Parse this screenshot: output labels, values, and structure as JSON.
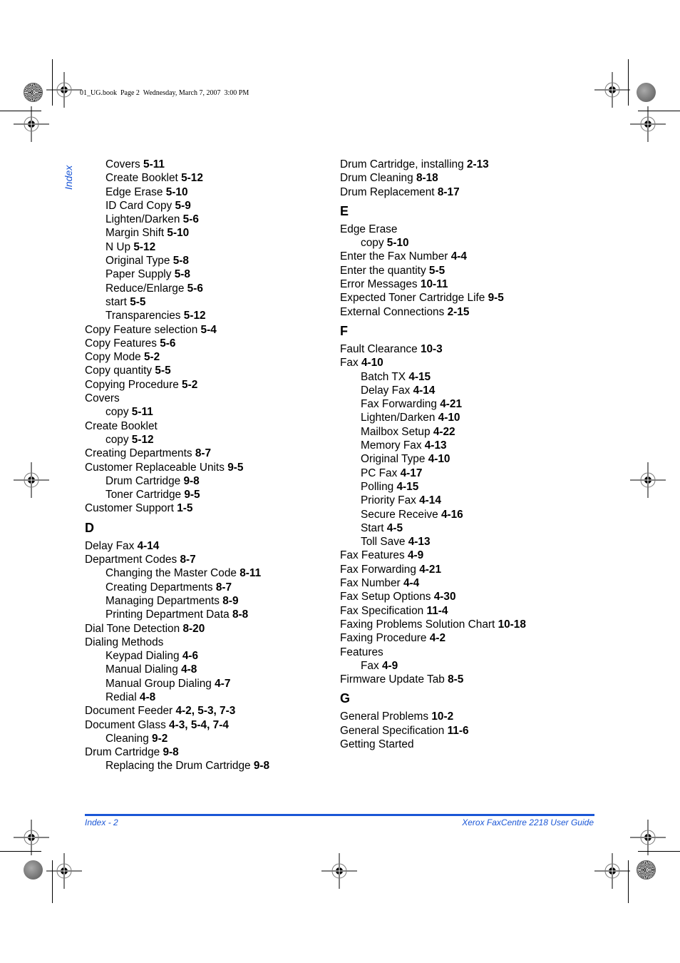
{
  "slug": "01_UG.book  Page 2  Wednesday, March 7, 2007  3:00 PM",
  "side_tab": "Index",
  "footer": {
    "left": "Index - 2",
    "right": "Xerox FaxCentre 2218 User Guide"
  },
  "colors": {
    "accent": "#1a56d6"
  },
  "left_column": [
    {
      "type": "sub",
      "text": "Covers",
      "pages": "5-11"
    },
    {
      "type": "sub",
      "text": "Create Booklet",
      "pages": "5-12"
    },
    {
      "type": "sub",
      "text": "Edge Erase",
      "pages": "5-10"
    },
    {
      "type": "sub",
      "text": "ID Card Copy",
      "pages": "5-9"
    },
    {
      "type": "sub",
      "text": "Lighten/Darken",
      "pages": "5-6"
    },
    {
      "type": "sub",
      "text": "Margin Shift",
      "pages": "5-10"
    },
    {
      "type": "sub",
      "text": "N Up",
      "pages": "5-12"
    },
    {
      "type": "sub",
      "text": "Original Type",
      "pages": "5-8"
    },
    {
      "type": "sub",
      "text": "Paper Supply",
      "pages": "5-8"
    },
    {
      "type": "sub",
      "text": "Reduce/Enlarge",
      "pages": "5-6"
    },
    {
      "type": "sub",
      "text": "start",
      "pages": "5-5"
    },
    {
      "type": "sub",
      "text": "Transparencies",
      "pages": "5-12"
    },
    {
      "type": "main",
      "text": "Copy Feature selection",
      "pages": "5-4"
    },
    {
      "type": "main",
      "text": "Copy Features",
      "pages": "5-6"
    },
    {
      "type": "main",
      "text": "Copy Mode",
      "pages": "5-2"
    },
    {
      "type": "main",
      "text": "Copy quantity",
      "pages": "5-5"
    },
    {
      "type": "main",
      "text": "Copying Procedure",
      "pages": "5-2"
    },
    {
      "type": "main",
      "text": "Covers",
      "pages": ""
    },
    {
      "type": "sub",
      "text": "copy",
      "pages": "5-11"
    },
    {
      "type": "main",
      "text": "Create Booklet",
      "pages": ""
    },
    {
      "type": "sub",
      "text": "copy",
      "pages": "5-12"
    },
    {
      "type": "main",
      "text": "Creating Departments",
      "pages": "8-7"
    },
    {
      "type": "main",
      "text": "Customer Replaceable Units",
      "pages": "9-5"
    },
    {
      "type": "sub",
      "text": "Drum Cartridge",
      "pages": "9-8"
    },
    {
      "type": "sub",
      "text": "Toner Cartridge",
      "pages": "9-5"
    },
    {
      "type": "main",
      "text": "Customer Support",
      "pages": "1-5"
    },
    {
      "type": "letter",
      "text": "D"
    },
    {
      "type": "main",
      "text": "Delay Fax",
      "pages": "4-14"
    },
    {
      "type": "main",
      "text": "Department Codes",
      "pages": "8-7"
    },
    {
      "type": "sub",
      "text": "Changing the Master Code",
      "pages": "8-11"
    },
    {
      "type": "sub",
      "text": "Creating Departments",
      "pages": "8-7"
    },
    {
      "type": "sub",
      "text": "Managing Departments",
      "pages": "8-9"
    },
    {
      "type": "sub",
      "text": "Printing Department Data",
      "pages": "8-8"
    },
    {
      "type": "main",
      "text": "Dial Tone Detection",
      "pages": "8-20"
    },
    {
      "type": "main",
      "text": "Dialing Methods",
      "pages": ""
    },
    {
      "type": "sub",
      "text": "Keypad Dialing",
      "pages": "4-6"
    },
    {
      "type": "sub",
      "text": "Manual Dialing",
      "pages": "4-8"
    },
    {
      "type": "sub",
      "text": "Manual Group Dialing",
      "pages": "4-7"
    },
    {
      "type": "sub",
      "text": "Redial",
      "pages": "4-8"
    },
    {
      "type": "main",
      "text": "Document Feeder",
      "pages": "4-2, 5-3, 7-3"
    },
    {
      "type": "main",
      "text": "Document Glass",
      "pages": "4-3, 5-4, 7-4"
    },
    {
      "type": "sub",
      "text": "Cleaning",
      "pages": "9-2"
    },
    {
      "type": "main",
      "text": "Drum Cartridge",
      "pages": "9-8"
    },
    {
      "type": "sub",
      "text": "Replacing the Drum Cartridge",
      "pages": "9-8"
    }
  ],
  "right_column": [
    {
      "type": "main",
      "text": "Drum Cartridge, installing",
      "pages": "2-13"
    },
    {
      "type": "main",
      "text": "Drum Cleaning",
      "pages": "8-18"
    },
    {
      "type": "main",
      "text": "Drum Replacement",
      "pages": "8-17"
    },
    {
      "type": "letter",
      "text": "E"
    },
    {
      "type": "main",
      "text": "Edge Erase",
      "pages": ""
    },
    {
      "type": "sub",
      "text": "copy",
      "pages": "5-10"
    },
    {
      "type": "main",
      "text": "Enter the Fax Number",
      "pages": "4-4"
    },
    {
      "type": "main",
      "text": "Enter the quantity",
      "pages": "5-5"
    },
    {
      "type": "main",
      "text": "Error Messages",
      "pages": "10-11"
    },
    {
      "type": "main",
      "text": "Expected Toner Cartridge Life",
      "pages": "9-5"
    },
    {
      "type": "main",
      "text": "External Connections",
      "pages": "2-15"
    },
    {
      "type": "letter",
      "text": "F"
    },
    {
      "type": "main",
      "text": "Fault Clearance",
      "pages": "10-3"
    },
    {
      "type": "main",
      "text": "Fax",
      "pages": "4-10"
    },
    {
      "type": "sub",
      "text": "Batch TX",
      "pages": "4-15"
    },
    {
      "type": "sub",
      "text": "Delay Fax",
      "pages": "4-14"
    },
    {
      "type": "sub",
      "text": "Fax Forwarding",
      "pages": "4-21"
    },
    {
      "type": "sub",
      "text": "Lighten/Darken",
      "pages": "4-10"
    },
    {
      "type": "sub",
      "text": "Mailbox Setup",
      "pages": "4-22"
    },
    {
      "type": "sub",
      "text": "Memory Fax",
      "pages": "4-13"
    },
    {
      "type": "sub",
      "text": "Original Type",
      "pages": "4-10"
    },
    {
      "type": "sub",
      "text": "PC Fax",
      "pages": "4-17"
    },
    {
      "type": "sub",
      "text": "Polling",
      "pages": "4-15"
    },
    {
      "type": "sub",
      "text": "Priority Fax",
      "pages": "4-14"
    },
    {
      "type": "sub",
      "text": "Secure Receive",
      "pages": "4-16"
    },
    {
      "type": "sub",
      "text": "Start",
      "pages": "4-5"
    },
    {
      "type": "sub",
      "text": "Toll Save",
      "pages": "4-13"
    },
    {
      "type": "main",
      "text": "Fax Features",
      "pages": "4-9"
    },
    {
      "type": "main",
      "text": "Fax Forwarding",
      "pages": "4-21"
    },
    {
      "type": "main",
      "text": "Fax Number",
      "pages": "4-4"
    },
    {
      "type": "main",
      "text": "Fax Setup Options",
      "pages": "4-30"
    },
    {
      "type": "main",
      "text": "Fax Specification",
      "pages": "11-4"
    },
    {
      "type": "main",
      "text": "Faxing Problems Solution Chart",
      "pages": "10-18"
    },
    {
      "type": "main",
      "text": "Faxing Procedure",
      "pages": "4-2"
    },
    {
      "type": "main",
      "text": "Features",
      "pages": ""
    },
    {
      "type": "sub",
      "text": "Fax",
      "pages": "4-9"
    },
    {
      "type": "main",
      "text": "Firmware Update Tab",
      "pages": "8-5"
    },
    {
      "type": "letter",
      "text": "G"
    },
    {
      "type": "main",
      "text": "General Problems",
      "pages": "10-2"
    },
    {
      "type": "main",
      "text": "General Specification",
      "pages": "11-6"
    },
    {
      "type": "main",
      "text": "Getting Started",
      "pages": ""
    }
  ]
}
